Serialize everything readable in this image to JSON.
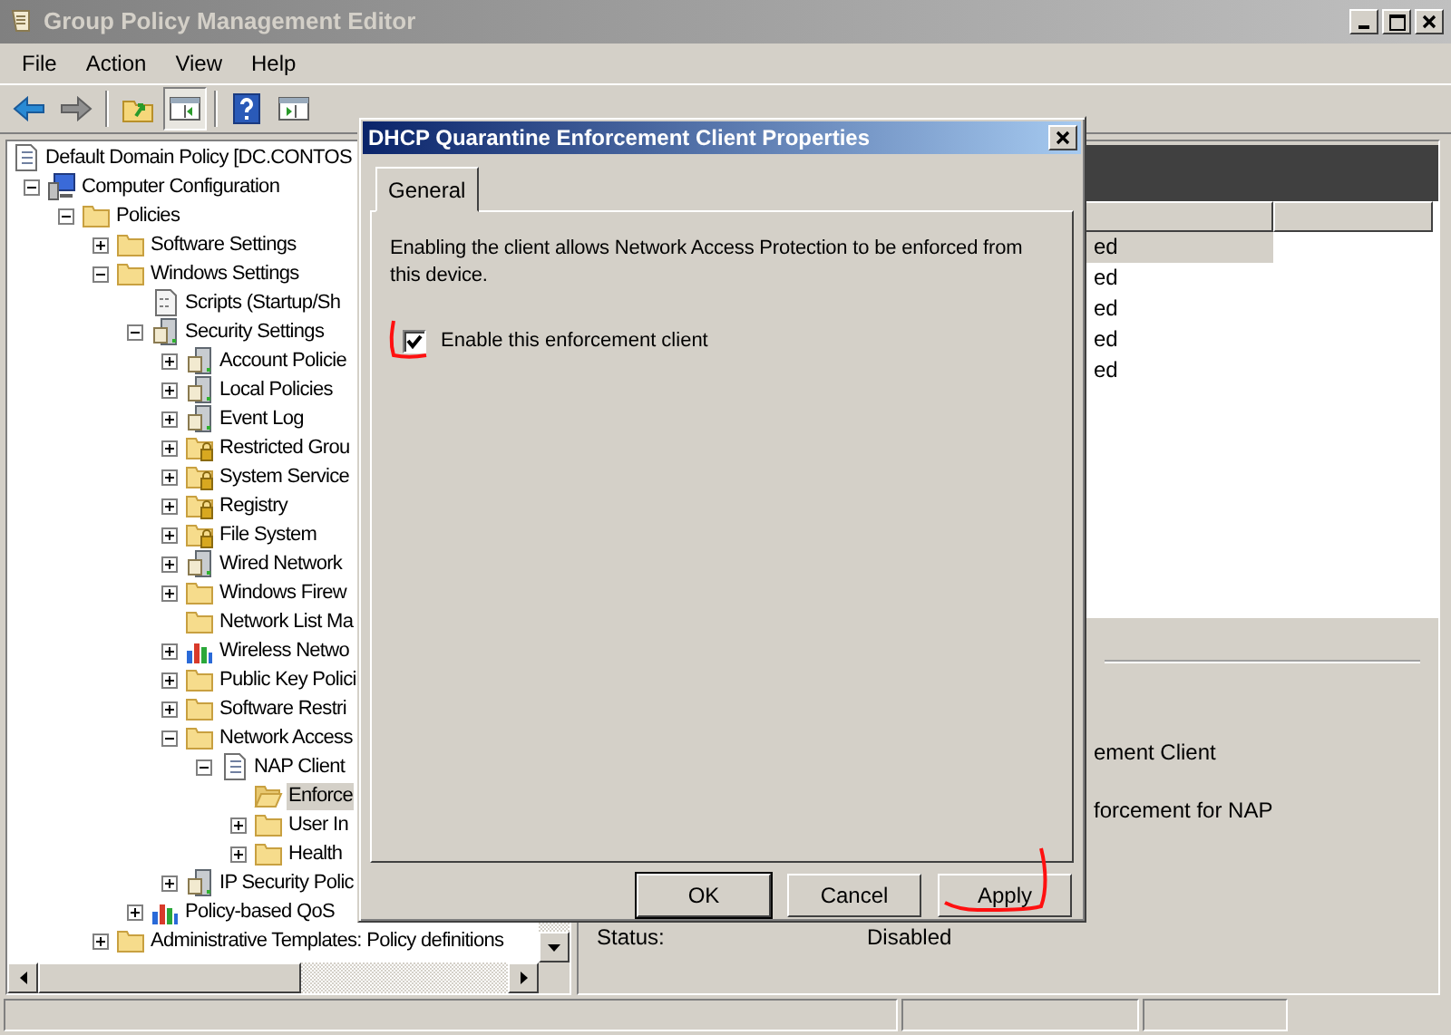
{
  "window": {
    "title": "Group Policy Management Editor"
  },
  "menu": [
    "File",
    "Action",
    "View",
    "Help"
  ],
  "tree": [
    {
      "label": "Default Domain Policy [DC.CONTOS",
      "kind": "document",
      "selected": false,
      "children": [
        {
          "label": "Computer Configuration",
          "kind": "computer",
          "expanded": true,
          "selected": false,
          "children": [
            {
              "label": "Policies",
              "kind": "folder",
              "expanded": true,
              "selected": false,
              "children": [
                {
                  "label": "Software Settings",
                  "kind": "folder",
                  "expanded": false,
                  "selected": false
                },
                {
                  "label": "Windows Settings",
                  "kind": "folder",
                  "expanded": true,
                  "selected": false,
                  "children": [
                    {
                      "label": "Scripts (Startup/Sh",
                      "kind": "script",
                      "selected": false
                    },
                    {
                      "label": "Security Settings",
                      "kind": "server",
                      "expanded": true,
                      "selected": false,
                      "children": [
                        {
                          "label": "Account Policie",
                          "kind": "server",
                          "expanded": false,
                          "selected": false
                        },
                        {
                          "label": "Local Policies",
                          "kind": "server",
                          "expanded": false,
                          "selected": false
                        },
                        {
                          "label": "Event Log",
                          "kind": "server",
                          "expanded": false,
                          "selected": false
                        },
                        {
                          "label": "Restricted Grou",
                          "kind": "locked",
                          "expanded": false,
                          "selected": false
                        },
                        {
                          "label": "System Service",
                          "kind": "locked",
                          "expanded": false,
                          "selected": false
                        },
                        {
                          "label": "Registry",
                          "kind": "locked",
                          "expanded": false,
                          "selected": false
                        },
                        {
                          "label": "File System",
                          "kind": "locked",
                          "expanded": false,
                          "selected": false
                        },
                        {
                          "label": "Wired Network",
                          "kind": "server",
                          "expanded": false,
                          "selected": false
                        },
                        {
                          "label": "Windows Firew",
                          "kind": "folder",
                          "expanded": false,
                          "selected": false
                        },
                        {
                          "label": "Network List Ma",
                          "kind": "folder",
                          "selected": false
                        },
                        {
                          "label": "Wireless Netwo",
                          "kind": "chart",
                          "expanded": false,
                          "selected": false
                        },
                        {
                          "label": "Public Key Polici",
                          "kind": "folder",
                          "expanded": false,
                          "selected": false
                        },
                        {
                          "label": "Software Restri",
                          "kind": "folder",
                          "expanded": false,
                          "selected": false
                        },
                        {
                          "label": "Network Access",
                          "kind": "folder",
                          "expanded": true,
                          "selected": false,
                          "children": [
                            {
                              "label": "NAP Client",
                              "kind": "document",
                              "expanded": true,
                              "selected": false,
                              "children": [
                                {
                                  "label": "Enforce",
                                  "kind": "open-folder",
                                  "selected": true
                                },
                                {
                                  "label": "User In",
                                  "kind": "folder",
                                  "expanded": false,
                                  "selected": false
                                },
                                {
                                  "label": "Health",
                                  "kind": "folder",
                                  "expanded": false,
                                  "selected": false
                                }
                              ]
                            }
                          ]
                        },
                        {
                          "label": "IP Security Polic",
                          "kind": "server",
                          "expanded": false,
                          "selected": false
                        }
                      ]
                    },
                    {
                      "label": "Policy-based QoS",
                      "kind": "chart",
                      "expanded": false,
                      "selected": false
                    }
                  ]
                },
                {
                  "label": "Administrative Templates: Policy definitions",
                  "kind": "folder",
                  "expanded": false,
                  "selected": false
                }
              ]
            }
          ]
        }
      ]
    }
  ],
  "details": {
    "rows": [
      {
        "text": "ed",
        "selected": true
      },
      {
        "text": "ed",
        "selected": false
      },
      {
        "text": "ed",
        "selected": false
      },
      {
        "text": "ed",
        "selected": false
      },
      {
        "text": "ed",
        "selected": false
      }
    ],
    "lines": [
      "ement Client",
      "forcement for NAP"
    ],
    "status_label": "Status:",
    "status_value": "Disabled"
  },
  "dialog": {
    "title": "DHCP Quarantine Enforcement Client Properties",
    "tabs": [
      {
        "label": "General",
        "selected": true
      }
    ],
    "description": "Enabling the client allows Network Access Protection to be enforced from this device.",
    "checkbox": {
      "label": "Enable this enforcement client",
      "checked": true
    },
    "buttons": [
      {
        "label": "OK",
        "default": true
      },
      {
        "label": "Cancel",
        "default": false
      },
      {
        "label": "Apply",
        "default": false
      }
    ]
  }
}
